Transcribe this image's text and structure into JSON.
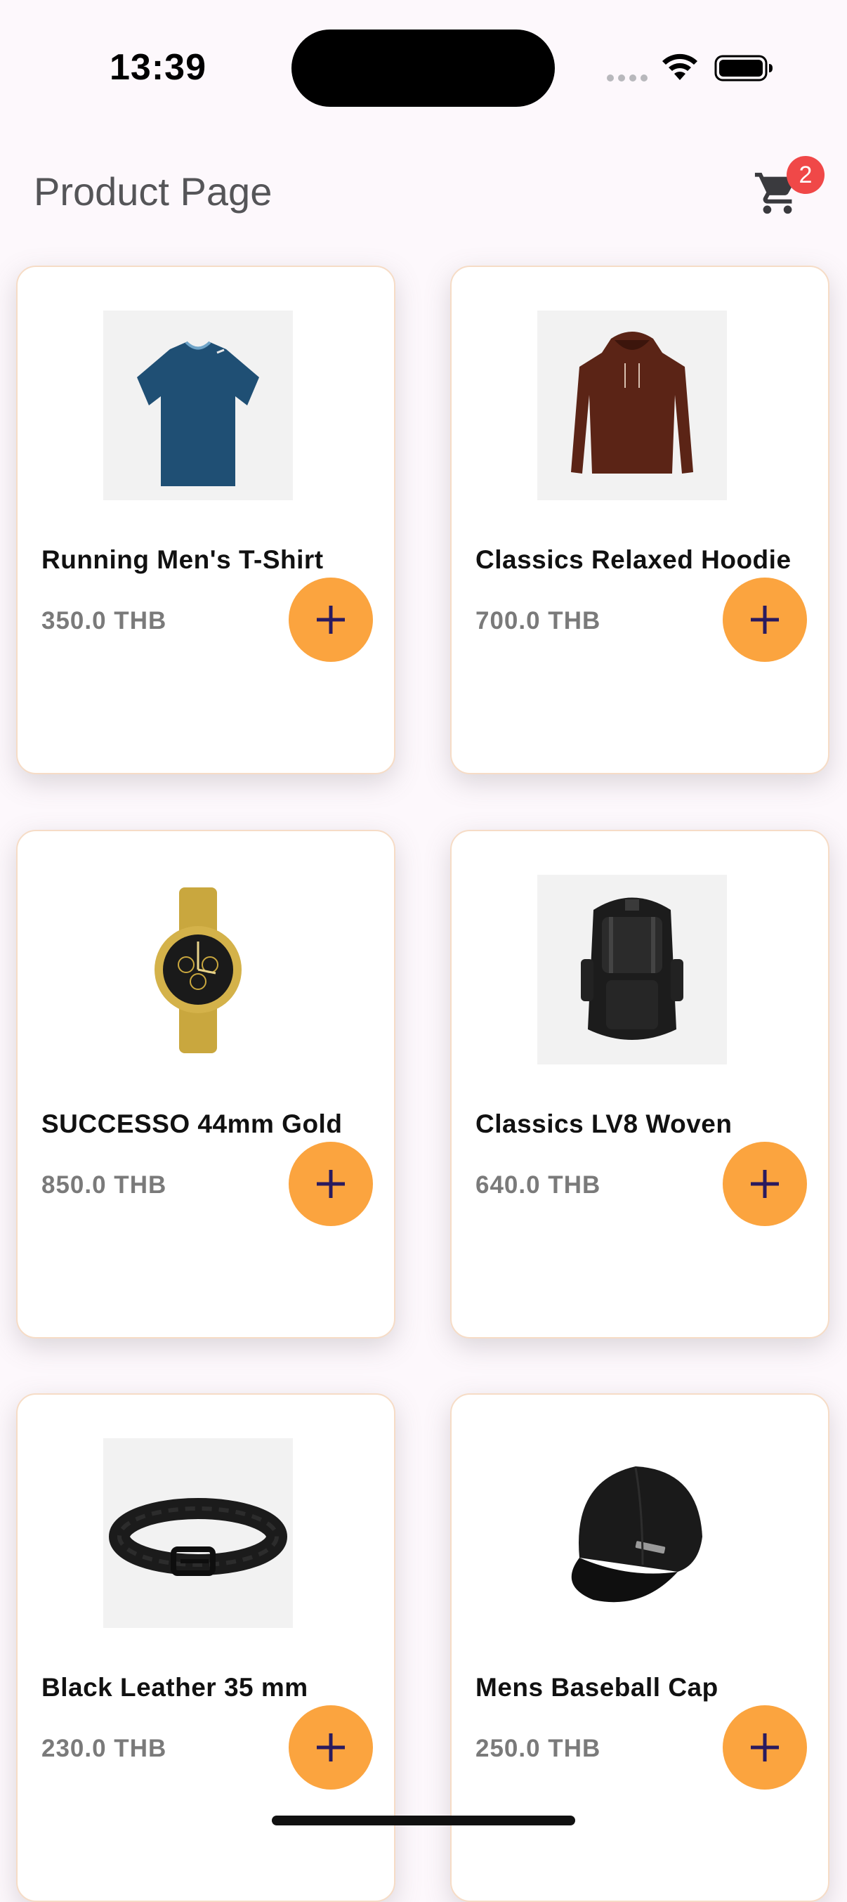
{
  "status_bar": {
    "time": "13:39"
  },
  "header": {
    "title": "Product Page",
    "cart_count": "2"
  },
  "products": [
    {
      "name": "Running Men's T-Shirt",
      "price": "350.0 THB",
      "image": "blue-tshirt-image"
    },
    {
      "name": "Classics Relaxed Hoodie",
      "price": "700.0 THB",
      "image": "brown-hoodie-image"
    },
    {
      "name": "SUCCESSO 44mm Gold",
      "price": "850.0 THB",
      "image": "gold-watch-image"
    },
    {
      "name": "Classics LV8 Woven",
      "price": "640.0 THB",
      "image": "black-backpack-image"
    },
    {
      "name": "Black Leather 35 mm",
      "price": "230.0 THB",
      "image": "black-belt-image"
    },
    {
      "name": "Mens Baseball Cap",
      "price": "250.0 THB",
      "image": "black-cap-image"
    }
  ],
  "colors": {
    "accent": "#fba43f",
    "badge": "#f04848",
    "icon_dark": "#2a1a5e"
  }
}
